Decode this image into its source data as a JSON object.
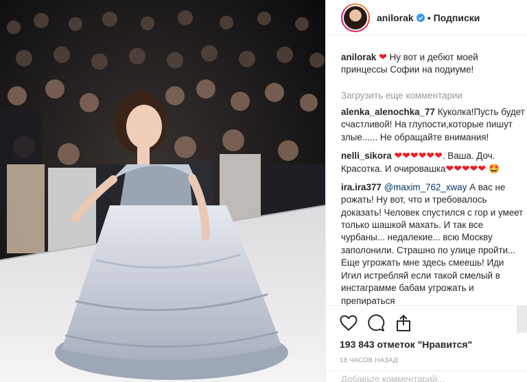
{
  "header": {
    "username": "anilorak",
    "separator": "•",
    "follow_label": "Подписки"
  },
  "caption": {
    "username": "anilorak",
    "emoji": "❤",
    "text": "Ну вот и дебют моей принцессы Софии на подиуме!"
  },
  "load_more_label": "Загрузить еще комментарии",
  "comments": [
    {
      "username": "alenka_alenochka_77",
      "text": "Куколка!Пусть будет счастливой! На глупости,которые пишут злые...... Не обращайте внимания!"
    },
    {
      "username": "nelli_sikora",
      "hearts_a": "❤❤❤❤❤❤",
      "text_a": ". Ваша. Доч. Красотка. И очировашка",
      "hearts_b": "❤❤❤❤❤",
      "emoji_end": "🤩"
    },
    {
      "username": "ira.ira377",
      "mention": "@maxim_762_xway",
      "text": "А вас не рожать! Ну вот, что и требовалось доказать! Человек спустился с гор и умеет только шашкой махать. И так все чурбаны... недалекие... всю Москву заполонили. Страшно по улице пройти... Еще угрожать мне здесь смеешь! Иди Игил истребляй если такой смелый в инстаграмме бабам угрожать и препираться"
    }
  ],
  "actions": {
    "likes_text": "193 843 отметок \"Нравится\"",
    "time_text": "18 часов назад",
    "add_comment_placeholder": "Добавьте комментарий..."
  },
  "colors": {
    "verified": "#3897f0",
    "heart": "#ed1c24",
    "mention": "#003569",
    "muted": "#999999"
  },
  "icons": [
    "heart-outline-icon",
    "comment-bubble-icon",
    "share-icon",
    "verified-badge-icon",
    "bookmark-icon"
  ]
}
